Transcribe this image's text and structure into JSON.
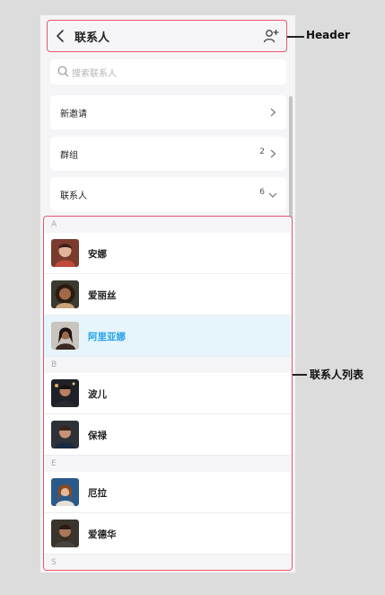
{
  "header": {
    "title": "联系人"
  },
  "search": {
    "placeholder": "搜索联系人"
  },
  "menu": [
    {
      "label": "新邀请",
      "count": ""
    },
    {
      "label": "群组",
      "count": "2"
    },
    {
      "label": "联系人",
      "count": "6"
    }
  ],
  "sections": [
    {
      "letter": "A",
      "contacts": [
        {
          "name": "安娜",
          "selected": false
        },
        {
          "name": "爱丽丝",
          "selected": false
        },
        {
          "name": "阿里亚娜",
          "selected": true
        }
      ]
    },
    {
      "letter": "B",
      "contacts": [
        {
          "name": "波儿",
          "selected": false
        },
        {
          "name": "保禄",
          "selected": false
        }
      ]
    },
    {
      "letter": "E",
      "contacts": [
        {
          "name": "厄拉",
          "selected": false
        },
        {
          "name": "爱德华",
          "selected": false
        }
      ]
    },
    {
      "letter": "S",
      "contacts": []
    }
  ],
  "callouts": {
    "header": "Header",
    "list": "联系人列表"
  },
  "colors": {
    "highlight_border": "#e8576a",
    "selected_text": "#27a3e6",
    "selected_bg": "#e6f4fc"
  }
}
